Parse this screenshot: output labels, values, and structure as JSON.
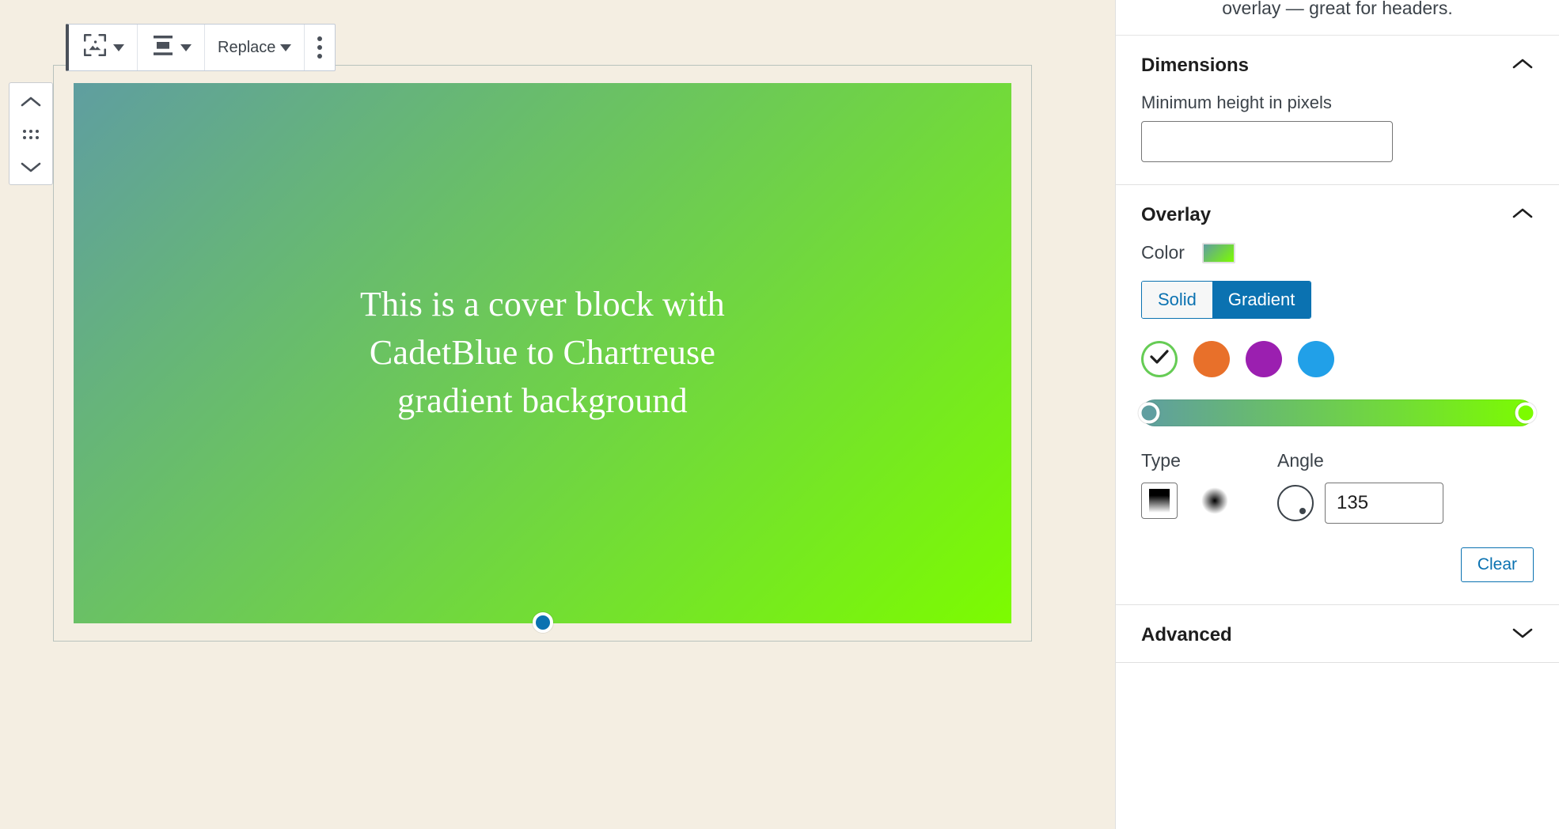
{
  "editor": {
    "toolbar": {
      "block_type_icon": "cover-block-icon",
      "block_type_caret": "chevron-down-icon",
      "align_icon": "vertical-align-center-icon",
      "align_caret": "chevron-down-icon",
      "replace_label": "Replace",
      "replace_caret": "chevron-down-icon",
      "more_options_icon": "kebab-menu-icon"
    },
    "mover": {
      "move_up_icon": "chevron-up-icon",
      "drag_handle_icon": "drag-handle-icon",
      "move_down_icon": "chevron-down-icon"
    },
    "cover_block": {
      "text": "This is a cover block with CadetBlue to Chartreuse gradient background",
      "gradient_css": "linear-gradient(135deg, #5f9ea0 0%, #7cfc00 100%)",
      "gradient_start_color": "#5f9ea0",
      "gradient_end_color": "#7cfc00",
      "resize_handle_color": "#0b72b1"
    }
  },
  "sidebar": {
    "intro_text": "overlay — great for headers.",
    "dimensions": {
      "title": "Dimensions",
      "collapse_icon": "chevron-up-icon",
      "min_height_label": "Minimum height in pixels",
      "min_height_value": "",
      "min_height_placeholder": ""
    },
    "overlay": {
      "title": "Overlay",
      "collapse_icon": "chevron-up-icon",
      "color_label": "Color",
      "color_swatch_gradient": "linear-gradient(135deg, #5f9ea0 0%, #7cfc00 100%)",
      "tabs": [
        {
          "label": "Solid",
          "active": false
        },
        {
          "label": "Gradient",
          "active": true
        }
      ],
      "accent_color": "#0b72b1",
      "presets": [
        {
          "name": "cadetblue-to-chartreuse",
          "color": "#ffffff",
          "selected": true,
          "ring": "#66cc55",
          "check_icon": "check-icon"
        },
        {
          "name": "orange-preset",
          "color": "#e8702a",
          "selected": false
        },
        {
          "name": "purple-preset",
          "color": "#9b1fb0",
          "selected": false
        },
        {
          "name": "blue-preset",
          "color": "#21a0e8",
          "selected": false
        }
      ],
      "slider": {
        "gradient_css": "linear-gradient(90deg, #5f9ea0 0%, #7cfc00 100%)",
        "stops": [
          {
            "name": "gradient-stop-start",
            "position_pct": 2,
            "color": "#5f9ea0"
          },
          {
            "name": "gradient-stop-end",
            "position_pct": 98,
            "color": "#7cfc00"
          }
        ]
      },
      "type_label": "Type",
      "type_options": [
        {
          "name": "linear-gradient-type",
          "selected": true
        },
        {
          "name": "radial-gradient-type",
          "selected": false
        }
      ],
      "angle_label": "Angle",
      "angle_value": "135",
      "clear_label": "Clear"
    },
    "advanced": {
      "title": "Advanced",
      "expand_icon": "chevron-down-icon"
    }
  }
}
